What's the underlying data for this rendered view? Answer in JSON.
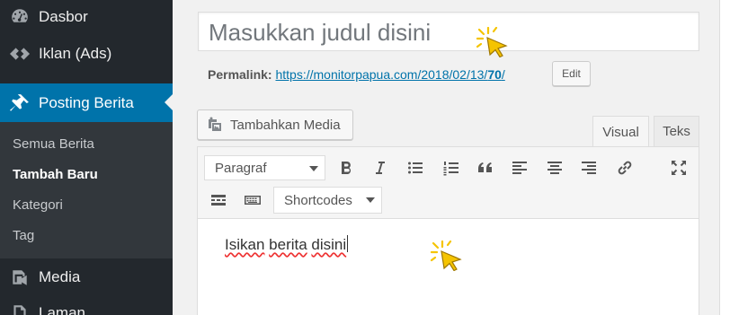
{
  "sidebar": {
    "items": [
      {
        "label": "Dasbor",
        "icon": "dashboard-icon"
      },
      {
        "label": "Iklan (Ads)",
        "icon": "ads-icon"
      },
      {
        "label": "Posting Berita",
        "icon": "pin-icon",
        "active": true
      },
      {
        "label": "Media",
        "icon": "media-icon"
      },
      {
        "label": "Laman",
        "icon": "pages-icon"
      }
    ],
    "submenu": [
      "Semua Berita",
      "Tambah Baru",
      "Kategori",
      "Tag"
    ],
    "accent": "#0073aa"
  },
  "editor": {
    "title_placeholder": "Masukkan judul disini",
    "permalink_label": "Permalink:",
    "permalink_base": "https://monitorpapua.com/2018/02/13/",
    "permalink_slug": "70",
    "permalink_end": "/",
    "edit_label": "Edit",
    "add_media_label": "Tambahkan Media",
    "tabs": [
      "Visual",
      "Teks"
    ],
    "format_select": "Paragraf",
    "shortcodes_select": "Shortcodes",
    "content_words": [
      "Isikan",
      "berita",
      "disini"
    ]
  }
}
